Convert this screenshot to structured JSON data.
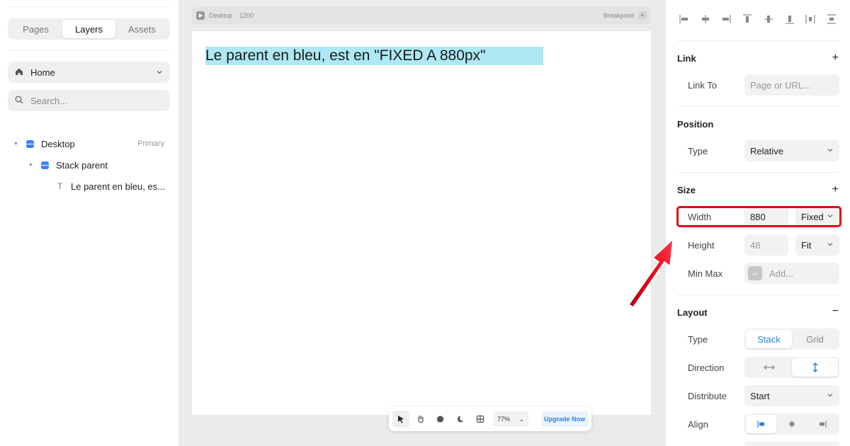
{
  "left": {
    "tabs": [
      "Pages",
      "Layers",
      "Assets"
    ],
    "active_tab": "Layers",
    "page_select": "Home",
    "search_placeholder": "Search...",
    "layers": [
      {
        "label": "Desktop",
        "badge": "Primary",
        "type": "stack"
      },
      {
        "label": "Stack parent",
        "badge": "",
        "type": "stack"
      },
      {
        "label": "Le parent en bleu, es...",
        "badge": "",
        "type": "text"
      }
    ]
  },
  "canvas": {
    "frame_name": "Desktop",
    "frame_width": "1200",
    "breakpoint_label": "Breakpoint",
    "text_content": "Le parent en bleu, est en \"FIXED A 880px\"",
    "zoom": "77%",
    "upgrade": "Upgrade Now"
  },
  "right": {
    "link": {
      "title": "Link",
      "link_to_label": "Link To",
      "link_to_placeholder": "Page or URL..."
    },
    "position": {
      "title": "Position",
      "type_label": "Type",
      "type_value": "Relative"
    },
    "size": {
      "title": "Size",
      "width_label": "Width",
      "width_value": "880",
      "width_mode": "Fixed",
      "height_label": "Height",
      "height_value": "48",
      "height_mode": "Fit",
      "minmax_label": "Min Max",
      "minmax_placeholder": "Add..."
    },
    "layout": {
      "title": "Layout",
      "type_label": "Type",
      "type_options": [
        "Stack",
        "Grid"
      ],
      "type_selected": "Stack",
      "direction_label": "Direction",
      "distribute_label": "Distribute",
      "distribute_value": "Start",
      "align_label": "Align"
    }
  },
  "colors": {
    "highlight": "#e3061a",
    "selection_text_bg": "#ade8f4",
    "accent": "#2a82e4"
  }
}
